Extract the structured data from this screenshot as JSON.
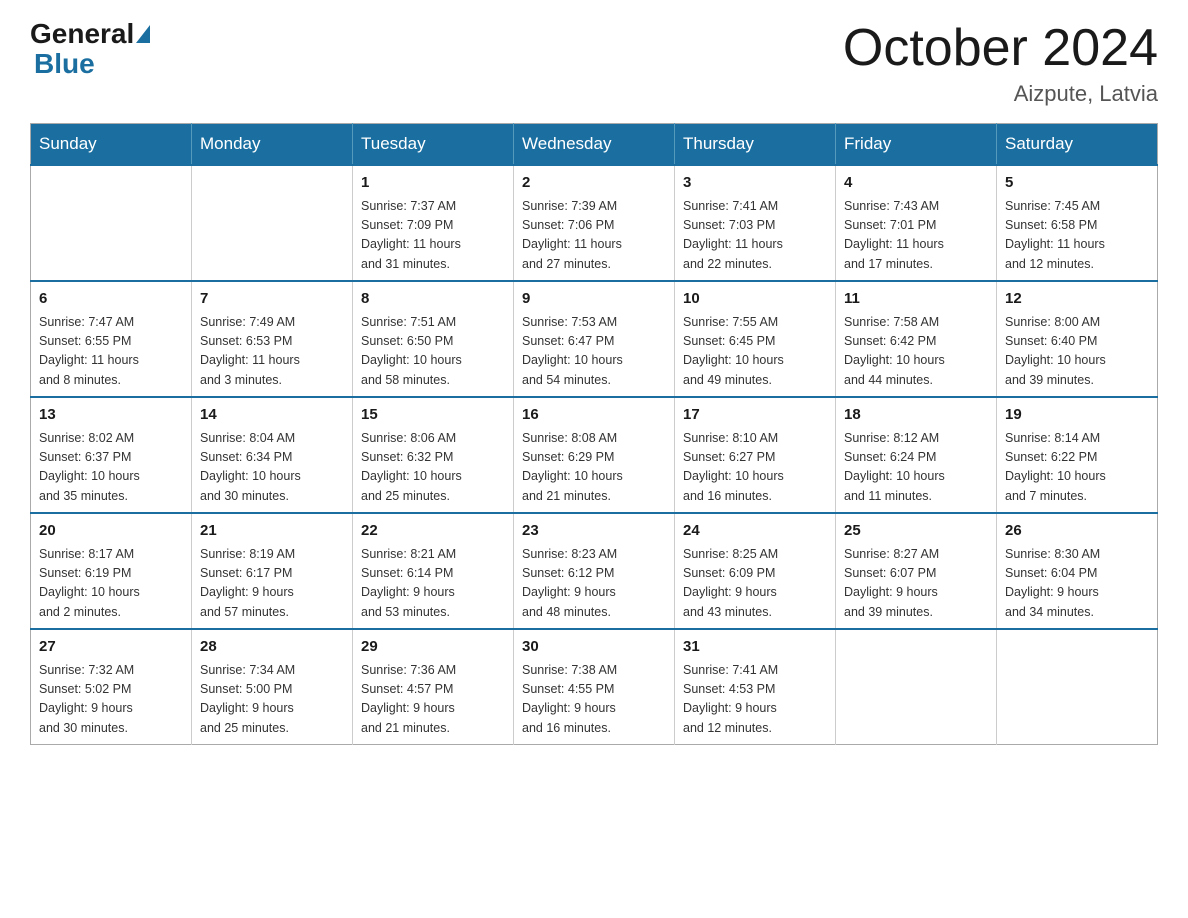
{
  "header": {
    "logo": {
      "general": "General",
      "blue": "Blue"
    },
    "title": "October 2024",
    "subtitle": "Aizpute, Latvia"
  },
  "weekdays": [
    "Sunday",
    "Monday",
    "Tuesday",
    "Wednesday",
    "Thursday",
    "Friday",
    "Saturday"
  ],
  "weeks": [
    [
      {
        "day": "",
        "info": ""
      },
      {
        "day": "",
        "info": ""
      },
      {
        "day": "1",
        "info": "Sunrise: 7:37 AM\nSunset: 7:09 PM\nDaylight: 11 hours\nand 31 minutes."
      },
      {
        "day": "2",
        "info": "Sunrise: 7:39 AM\nSunset: 7:06 PM\nDaylight: 11 hours\nand 27 minutes."
      },
      {
        "day": "3",
        "info": "Sunrise: 7:41 AM\nSunset: 7:03 PM\nDaylight: 11 hours\nand 22 minutes."
      },
      {
        "day": "4",
        "info": "Sunrise: 7:43 AM\nSunset: 7:01 PM\nDaylight: 11 hours\nand 17 minutes."
      },
      {
        "day": "5",
        "info": "Sunrise: 7:45 AM\nSunset: 6:58 PM\nDaylight: 11 hours\nand 12 minutes."
      }
    ],
    [
      {
        "day": "6",
        "info": "Sunrise: 7:47 AM\nSunset: 6:55 PM\nDaylight: 11 hours\nand 8 minutes."
      },
      {
        "day": "7",
        "info": "Sunrise: 7:49 AM\nSunset: 6:53 PM\nDaylight: 11 hours\nand 3 minutes."
      },
      {
        "day": "8",
        "info": "Sunrise: 7:51 AM\nSunset: 6:50 PM\nDaylight: 10 hours\nand 58 minutes."
      },
      {
        "day": "9",
        "info": "Sunrise: 7:53 AM\nSunset: 6:47 PM\nDaylight: 10 hours\nand 54 minutes."
      },
      {
        "day": "10",
        "info": "Sunrise: 7:55 AM\nSunset: 6:45 PM\nDaylight: 10 hours\nand 49 minutes."
      },
      {
        "day": "11",
        "info": "Sunrise: 7:58 AM\nSunset: 6:42 PM\nDaylight: 10 hours\nand 44 minutes."
      },
      {
        "day": "12",
        "info": "Sunrise: 8:00 AM\nSunset: 6:40 PM\nDaylight: 10 hours\nand 39 minutes."
      }
    ],
    [
      {
        "day": "13",
        "info": "Sunrise: 8:02 AM\nSunset: 6:37 PM\nDaylight: 10 hours\nand 35 minutes."
      },
      {
        "day": "14",
        "info": "Sunrise: 8:04 AM\nSunset: 6:34 PM\nDaylight: 10 hours\nand 30 minutes."
      },
      {
        "day": "15",
        "info": "Sunrise: 8:06 AM\nSunset: 6:32 PM\nDaylight: 10 hours\nand 25 minutes."
      },
      {
        "day": "16",
        "info": "Sunrise: 8:08 AM\nSunset: 6:29 PM\nDaylight: 10 hours\nand 21 minutes."
      },
      {
        "day": "17",
        "info": "Sunrise: 8:10 AM\nSunset: 6:27 PM\nDaylight: 10 hours\nand 16 minutes."
      },
      {
        "day": "18",
        "info": "Sunrise: 8:12 AM\nSunset: 6:24 PM\nDaylight: 10 hours\nand 11 minutes."
      },
      {
        "day": "19",
        "info": "Sunrise: 8:14 AM\nSunset: 6:22 PM\nDaylight: 10 hours\nand 7 minutes."
      }
    ],
    [
      {
        "day": "20",
        "info": "Sunrise: 8:17 AM\nSunset: 6:19 PM\nDaylight: 10 hours\nand 2 minutes."
      },
      {
        "day": "21",
        "info": "Sunrise: 8:19 AM\nSunset: 6:17 PM\nDaylight: 9 hours\nand 57 minutes."
      },
      {
        "day": "22",
        "info": "Sunrise: 8:21 AM\nSunset: 6:14 PM\nDaylight: 9 hours\nand 53 minutes."
      },
      {
        "day": "23",
        "info": "Sunrise: 8:23 AM\nSunset: 6:12 PM\nDaylight: 9 hours\nand 48 minutes."
      },
      {
        "day": "24",
        "info": "Sunrise: 8:25 AM\nSunset: 6:09 PM\nDaylight: 9 hours\nand 43 minutes."
      },
      {
        "day": "25",
        "info": "Sunrise: 8:27 AM\nSunset: 6:07 PM\nDaylight: 9 hours\nand 39 minutes."
      },
      {
        "day": "26",
        "info": "Sunrise: 8:30 AM\nSunset: 6:04 PM\nDaylight: 9 hours\nand 34 minutes."
      }
    ],
    [
      {
        "day": "27",
        "info": "Sunrise: 7:32 AM\nSunset: 5:02 PM\nDaylight: 9 hours\nand 30 minutes."
      },
      {
        "day": "28",
        "info": "Sunrise: 7:34 AM\nSunset: 5:00 PM\nDaylight: 9 hours\nand 25 minutes."
      },
      {
        "day": "29",
        "info": "Sunrise: 7:36 AM\nSunset: 4:57 PM\nDaylight: 9 hours\nand 21 minutes."
      },
      {
        "day": "30",
        "info": "Sunrise: 7:38 AM\nSunset: 4:55 PM\nDaylight: 9 hours\nand 16 minutes."
      },
      {
        "day": "31",
        "info": "Sunrise: 7:41 AM\nSunset: 4:53 PM\nDaylight: 9 hours\nand 12 minutes."
      },
      {
        "day": "",
        "info": ""
      },
      {
        "day": "",
        "info": ""
      }
    ]
  ]
}
